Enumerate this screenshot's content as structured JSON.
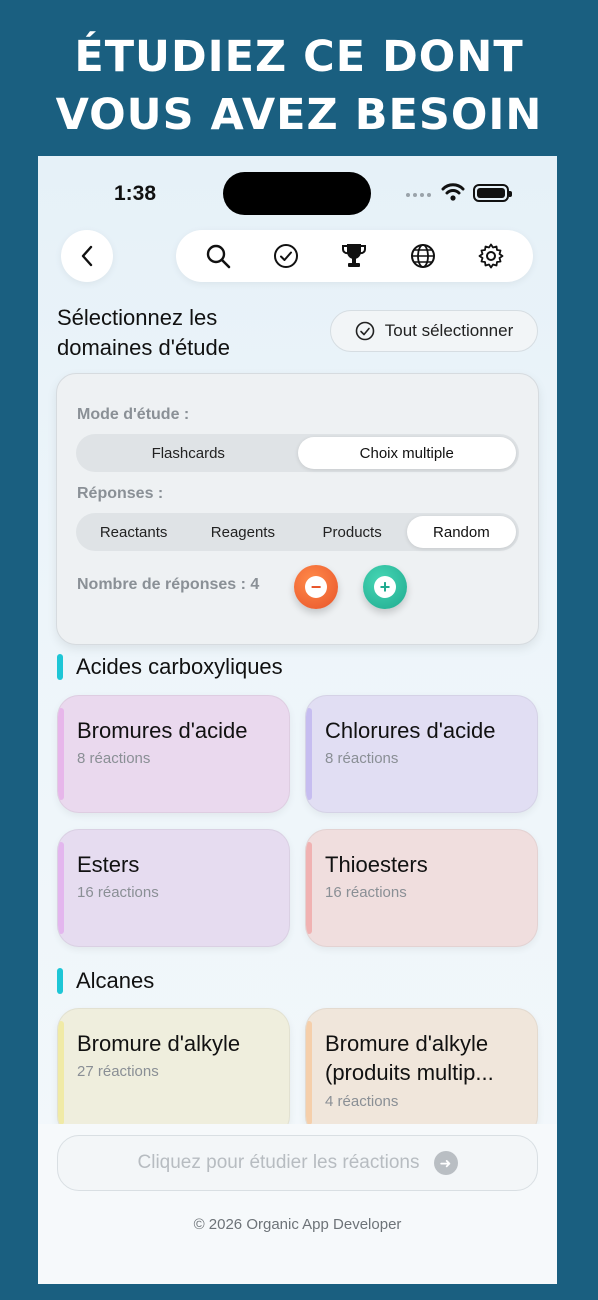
{
  "promo": {
    "line1": "ÉTUDIEZ CE DONT",
    "line2": "VOUS AVEZ BESOIN"
  },
  "status_bar": {
    "time": "1:38"
  },
  "nav": {
    "icons": [
      "back-icon",
      "search-icon",
      "check-circle-icon",
      "trophy-icon",
      "globe-icon",
      "gear-icon"
    ]
  },
  "header": {
    "title": "Sélectionnez les domaines d'étude",
    "select_all_label": "Tout sélectionner"
  },
  "settings": {
    "study_mode_label": "Mode d'étude :",
    "study_modes": [
      "Flashcards",
      "Choix multiple"
    ],
    "study_mode_selected": "Choix multiple",
    "answers_label": "Réponses :",
    "answer_options": [
      "Reactants",
      "Reagents",
      "Products",
      "Random"
    ],
    "answer_selected": "Random",
    "answer_count_label": "Nombre de réponses : 4",
    "answer_count": 4
  },
  "categories": [
    {
      "name": "Acides carboxyliques",
      "cards": [
        {
          "title": "Bromures d'acide",
          "subtitle": "8 réactions",
          "color": "#ead9ee",
          "accent": "#e7b6ea"
        },
        {
          "title": "Chlorures d'acide",
          "subtitle": "8 réactions",
          "color": "#e1def3",
          "accent": "#c6bdf0"
        },
        {
          "title": "Esters",
          "subtitle": "16 réactions",
          "color": "#e6dcf0",
          "accent": "#e3b6ee"
        },
        {
          "title": "Thioesters",
          "subtitle": "16 réactions",
          "color": "#f0dede",
          "accent": "#f0b2b2"
        }
      ]
    },
    {
      "name": "Alcanes",
      "cards": [
        {
          "title": "Bromure d'alkyle",
          "subtitle": "27 réactions",
          "color": "#efeedd",
          "accent": "#f0eaa6"
        },
        {
          "title": "Bromure d'alkyle (produits multip...",
          "subtitle": "4 réactions",
          "color": "#f0e6db",
          "accent": "#f5cfab"
        }
      ]
    }
  ],
  "cta": {
    "label": "Cliquez pour étudier les réactions"
  },
  "footer": {
    "text": "© 2026 Organic App Developer"
  },
  "colors": {
    "background": "#1a5f80",
    "accent_bar": "#1ec6d6",
    "minus": "#e8542a",
    "plus": "#20aa8f"
  }
}
